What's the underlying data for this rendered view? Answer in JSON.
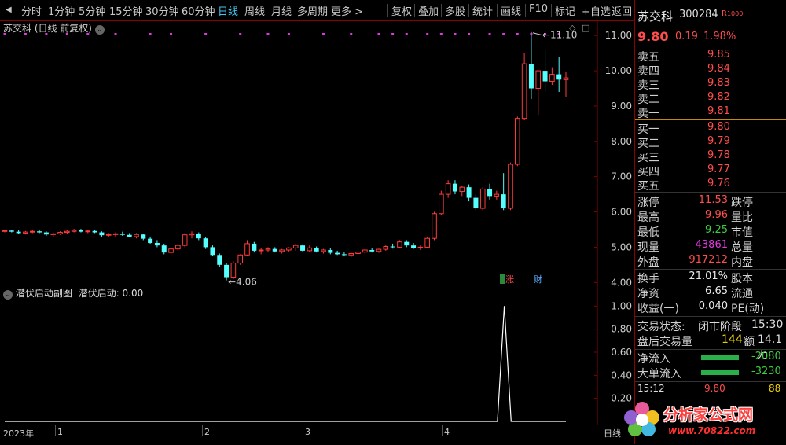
{
  "toolbar": {
    "periods": [
      "分时",
      "1分钟",
      "5分钟",
      "15分钟",
      "30分钟",
      "60分钟",
      "日线",
      "周线",
      "月线",
      "多周期",
      "更多 >"
    ],
    "active_period": "日线",
    "tools": [
      "复权",
      "叠加",
      "多股",
      "统计",
      "画线",
      "F10",
      "标记",
      "+自选",
      "返回"
    ]
  },
  "main_chart": {
    "title": "苏交科 (日线 前复权)",
    "high_note": "11.10",
    "low_note": "4.06",
    "tags": [
      "涨",
      "财"
    ]
  },
  "sub_chart": {
    "title": "潜伏启动副图",
    "value_label": "潜伏启动: 0.00"
  },
  "time_axis": {
    "labels": [
      "2023年",
      "1",
      "2",
      "3",
      "4",
      "日线"
    ]
  },
  "chart_data": [
    {
      "type": "candlestick",
      "title": "苏交科 (日线 前复权)",
      "y_ticks": [
        4.0,
        5.0,
        6.0,
        7.0,
        8.0,
        9.0,
        10.0,
        11.0
      ],
      "ylim": [
        3.85,
        11.25
      ],
      "annotations": [
        {
          "text": "11.10",
          "kind": "high"
        },
        {
          "text": "4.06",
          "kind": "low"
        }
      ],
      "ohlc": [
        [
          5.45,
          5.5,
          5.42,
          5.47
        ],
        [
          5.47,
          5.5,
          5.42,
          5.44
        ],
        [
          5.44,
          5.48,
          5.38,
          5.4
        ],
        [
          5.4,
          5.46,
          5.36,
          5.43
        ],
        [
          5.43,
          5.48,
          5.4,
          5.45
        ],
        [
          5.45,
          5.5,
          5.4,
          5.42
        ],
        [
          5.42,
          5.45,
          5.32,
          5.36
        ],
        [
          5.36,
          5.42,
          5.3,
          5.38
        ],
        [
          5.38,
          5.45,
          5.35,
          5.42
        ],
        [
          5.42,
          5.48,
          5.38,
          5.45
        ],
        [
          5.45,
          5.52,
          5.42,
          5.48
        ],
        [
          5.48,
          5.52,
          5.42,
          5.44
        ],
        [
          5.44,
          5.48,
          5.4,
          5.46
        ],
        [
          5.46,
          5.5,
          5.4,
          5.42
        ],
        [
          5.42,
          5.45,
          5.3,
          5.34
        ],
        [
          5.34,
          5.4,
          5.28,
          5.36
        ],
        [
          5.36,
          5.42,
          5.3,
          5.38
        ],
        [
          5.38,
          5.44,
          5.32,
          5.35
        ],
        [
          5.35,
          5.4,
          5.28,
          5.3
        ],
        [
          5.3,
          5.4,
          5.25,
          5.36
        ],
        [
          5.36,
          5.38,
          5.2,
          5.24
        ],
        [
          5.24,
          5.3,
          5.1,
          5.12
        ],
        [
          5.12,
          5.2,
          5.0,
          5.05
        ],
        [
          5.05,
          5.1,
          4.8,
          4.85
        ],
        [
          4.85,
          5.0,
          4.78,
          4.95
        ],
        [
          4.95,
          5.1,
          4.9,
          5.05
        ],
        [
          5.05,
          5.4,
          5.0,
          5.35
        ],
        [
          5.35,
          5.45,
          5.25,
          5.38
        ],
        [
          5.38,
          5.42,
          5.2,
          5.25
        ],
        [
          5.25,
          5.3,
          4.95,
          5.0
        ],
        [
          5.0,
          5.05,
          4.75,
          4.78
        ],
        [
          4.78,
          4.82,
          4.45,
          4.5
        ],
        [
          4.5,
          4.55,
          4.06,
          4.15
        ],
        [
          4.15,
          4.6,
          4.1,
          4.55
        ],
        [
          4.55,
          4.8,
          4.5,
          4.78
        ],
        [
          4.78,
          5.2,
          4.75,
          5.1
        ],
        [
          5.1,
          5.15,
          4.85,
          4.9
        ],
        [
          4.9,
          4.98,
          4.8,
          4.92
        ],
        [
          4.92,
          5.0,
          4.85,
          4.95
        ],
        [
          4.95,
          5.0,
          4.85,
          4.88
        ],
        [
          4.88,
          4.95,
          4.82,
          4.92
        ],
        [
          4.92,
          5.0,
          4.88,
          4.98
        ],
        [
          4.98,
          5.1,
          4.9,
          5.05
        ],
        [
          5.05,
          5.08,
          4.88,
          4.9
        ],
        [
          4.9,
          5.05,
          4.86,
          4.98
        ],
        [
          4.98,
          5.02,
          4.85,
          4.88
        ],
        [
          4.88,
          4.95,
          4.82,
          4.92
        ],
        [
          4.92,
          4.98,
          4.8,
          4.84
        ],
        [
          4.84,
          4.9,
          4.78,
          4.8
        ],
        [
          4.8,
          4.86,
          4.74,
          4.78
        ],
        [
          4.78,
          4.85,
          4.72,
          4.82
        ],
        [
          4.82,
          4.9,
          4.78,
          4.86
        ],
        [
          4.86,
          4.95,
          4.82,
          4.92
        ],
        [
          4.92,
          4.98,
          4.85,
          4.88
        ],
        [
          4.88,
          4.96,
          4.84,
          4.94
        ],
        [
          4.94,
          5.05,
          4.9,
          5.02
        ],
        [
          5.02,
          5.1,
          4.96,
          5.0
        ],
        [
          5.0,
          5.2,
          4.98,
          5.15
        ],
        [
          5.15,
          5.2,
          5.0,
          5.05
        ],
        [
          5.05,
          5.12,
          4.95,
          4.98
        ],
        [
          4.98,
          5.05,
          4.92,
          5.0
        ],
        [
          5.0,
          5.3,
          4.98,
          5.25
        ],
        [
          5.25,
          6.0,
          5.2,
          5.95
        ],
        [
          5.95,
          6.6,
          5.9,
          6.5
        ],
        [
          6.5,
          6.9,
          6.4,
          6.8
        ],
        [
          6.8,
          6.9,
          6.5,
          6.58
        ],
        [
          6.58,
          6.75,
          6.45,
          6.7
        ],
        [
          6.7,
          6.78,
          6.3,
          6.4
        ],
        [
          6.4,
          6.5,
          6.05,
          6.1
        ],
        [
          6.1,
          6.7,
          6.05,
          6.65
        ],
        [
          6.65,
          6.8,
          6.35,
          6.45
        ],
        [
          6.45,
          6.6,
          6.35,
          6.5
        ],
        [
          6.5,
          7.1,
          6.05,
          6.1
        ],
        [
          6.1,
          7.4,
          6.05,
          7.35
        ],
        [
          7.35,
          8.7,
          7.3,
          8.65
        ],
        [
          8.65,
          10.5,
          8.6,
          10.2
        ],
        [
          10.2,
          11.1,
          9.2,
          9.5
        ],
        [
          9.5,
          10.0,
          8.75,
          10.0
        ],
        [
          10.0,
          10.6,
          9.4,
          9.7
        ],
        [
          9.7,
          10.1,
          9.6,
          9.9
        ],
        [
          9.9,
          10.4,
          9.4,
          9.75
        ],
        [
          9.75,
          9.96,
          9.25,
          9.8
        ]
      ]
    },
    {
      "type": "line",
      "title": "潜伏启动副图",
      "y_ticks": [
        0.2,
        0.4,
        0.6,
        0.8,
        1.0
      ],
      "ylim": [
        0,
        1.05
      ],
      "series": [
        {
          "name": "潜伏启动",
          "values": [
            0,
            0,
            0,
            0,
            0,
            0,
            0,
            0,
            0,
            0,
            0,
            0,
            0,
            0,
            0,
            0,
            0,
            0,
            0,
            0,
            0,
            0,
            0,
            0,
            0,
            0,
            0,
            0,
            0,
            0,
            0,
            0,
            0,
            0,
            0,
            0,
            0,
            0,
            0,
            0,
            0,
            0,
            0,
            0,
            0,
            0,
            0,
            0,
            0,
            0,
            0,
            0,
            0,
            0,
            0,
            0,
            0,
            0,
            0,
            0,
            0,
            0,
            0,
            0,
            0,
            0,
            0,
            0,
            0,
            0,
            0,
            0,
            0,
            1,
            0,
            0,
            0,
            0,
            0,
            0,
            0,
            0,
            0
          ]
        }
      ]
    }
  ],
  "quote_panel": {
    "name": "苏交科",
    "code": "300284",
    "badge": "R",
    "badge2": "1000",
    "price": "9.80",
    "change": "0.19",
    "pct": "1.98%",
    "asks": [
      {
        "label": "卖五",
        "price": "9.85"
      },
      {
        "label": "卖四",
        "price": "9.84"
      },
      {
        "label": "卖三",
        "price": "9.83"
      },
      {
        "label": "卖二",
        "price": "9.82"
      },
      {
        "label": "卖一",
        "price": "9.81"
      }
    ],
    "bids": [
      {
        "label": "买一",
        "price": "9.80"
      },
      {
        "label": "买二",
        "price": "9.79"
      },
      {
        "label": "买三",
        "price": "9.78"
      },
      {
        "label": "买四",
        "price": "9.77"
      },
      {
        "label": "买五",
        "price": "9.76"
      }
    ],
    "stats": [
      {
        "l1": "涨停",
        "v1": "11.53",
        "l2": "跌停",
        "c": "red"
      },
      {
        "l1": "最高",
        "v1": "9.96",
        "l2": "量比",
        "c": "red"
      },
      {
        "l1": "最低",
        "v1": "9.25",
        "l2": "市值",
        "c": "green"
      },
      {
        "l1": "现量",
        "v1": "43861",
        "l2": "总量",
        "c": "magenta"
      },
      {
        "l1": "外盘",
        "v1": "917212",
        "l2": "内盘",
        "c": "red"
      }
    ],
    "stats2": [
      {
        "l1": "换手",
        "v1": "21.01%",
        "l2": "股本"
      },
      {
        "l1": "净资",
        "v1": "6.65",
        "l2": "流通"
      },
      {
        "l1": "收益(一)",
        "v1": "0.040",
        "l2": "PE(动)"
      }
    ],
    "trade_state_label": "交易状态:",
    "trade_state_value": "闭市阶段",
    "trade_state_time": "15:30",
    "after_label": "盘后交易量",
    "after_vol": "144",
    "after_amt_label": "额",
    "after_amt": "14.1万",
    "flows": [
      {
        "label": "净流入",
        "value": "-2080"
      },
      {
        "label": "大单流入",
        "value": "-3230"
      }
    ],
    "tick_time": "15:12",
    "tick_price": "9.80",
    "tick_vol": "88"
  },
  "watermark": {
    "text": "分析家公式网",
    "url": "www.70822.com"
  },
  "colors": {
    "up": "#ff3b3b",
    "down": "#54ffff",
    "dot": "#e038e0",
    "axis_red": "#8b0000"
  }
}
